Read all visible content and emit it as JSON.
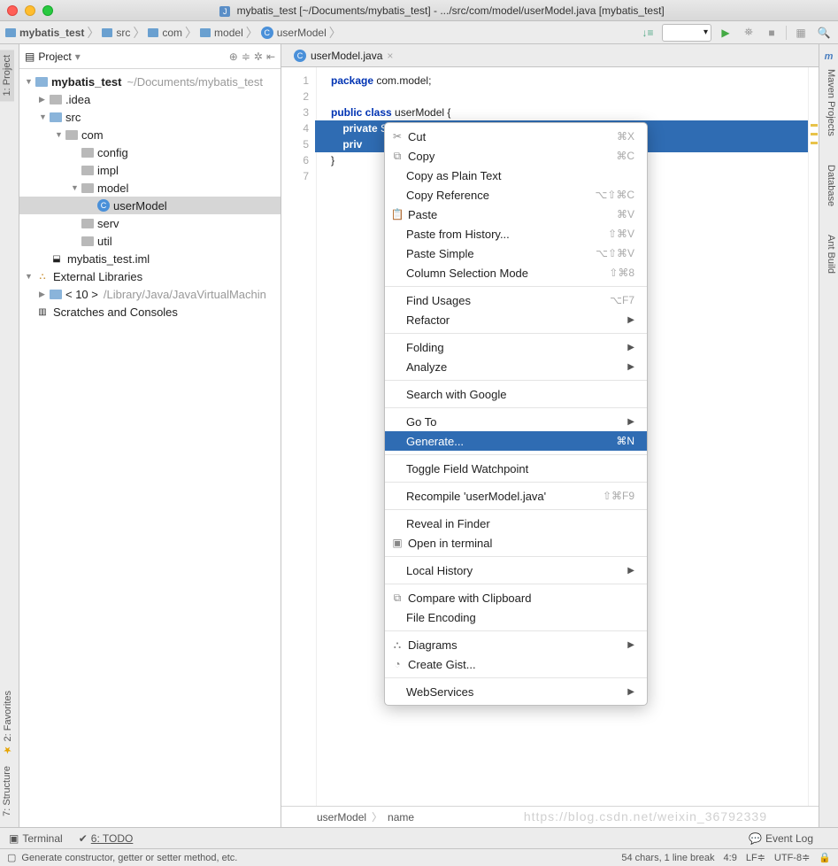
{
  "title": "mybatis_test [~/Documents/mybatis_test] - .../src/com/model/userModel.java [mybatis_test]",
  "breadcrumbs": [
    "mybatis_test",
    "src",
    "com",
    "model",
    "userModel"
  ],
  "project_panel": {
    "title": "Project",
    "tree": {
      "root": "mybatis_test",
      "root_path": "~/Documents/mybatis_test",
      "idea": ".idea",
      "src": "src",
      "com": "com",
      "config": "config",
      "impl": "impl",
      "model": "model",
      "userModel": "userModel",
      "serv": "serv",
      "util": "util",
      "iml": "mybatis_test.iml",
      "ext": "External Libraries",
      "jdk": "< 10 >",
      "jdk_path": "/Library/Java/JavaVirtualMachin",
      "scratches": "Scratches and Consoles"
    }
  },
  "editor": {
    "tab_label": "userModel.java",
    "lines": [
      "1",
      "2",
      "3",
      "4",
      "5",
      "6",
      "7"
    ],
    "code": {
      "l1_pre": "package ",
      "l1_pkg": "com.model;",
      "l3_a": "public class ",
      "l3_b": "userModel {",
      "l4_a": "private ",
      "l4_b": "String name;",
      "l5_a": "priv",
      "l6": "}"
    },
    "bc1": "userModel",
    "bc2": "name"
  },
  "context_menu": [
    {
      "label": "Cut",
      "icon": "✂",
      "shortcut": "⌘X"
    },
    {
      "label": "Copy",
      "icon": "⧉",
      "shortcut": "⌘C"
    },
    {
      "label": "Copy as Plain Text"
    },
    {
      "label": "Copy Reference",
      "shortcut": "⌥⇧⌘C"
    },
    {
      "label": "Paste",
      "icon": "📋",
      "shortcut": "⌘V"
    },
    {
      "label": "Paste from History...",
      "shortcut": "⇧⌘V"
    },
    {
      "label": "Paste Simple",
      "shortcut": "⌥⇧⌘V"
    },
    {
      "label": "Column Selection Mode",
      "shortcut": "⇧⌘8"
    },
    {
      "sep": true
    },
    {
      "label": "Find Usages",
      "shortcut": "⌥F7"
    },
    {
      "label": "Refactor",
      "sub": true
    },
    {
      "sep": true
    },
    {
      "label": "Folding",
      "sub": true
    },
    {
      "label": "Analyze",
      "sub": true
    },
    {
      "sep": true
    },
    {
      "label": "Search with Google"
    },
    {
      "sep": true
    },
    {
      "label": "Go To",
      "sub": true
    },
    {
      "label": "Generate...",
      "shortcut": "⌘N",
      "hl": true
    },
    {
      "sep": true
    },
    {
      "label": "Toggle Field Watchpoint"
    },
    {
      "sep": true
    },
    {
      "label": "Recompile 'userModel.java'",
      "shortcut": "⇧⌘F9"
    },
    {
      "sep": true
    },
    {
      "label": "Reveal in Finder"
    },
    {
      "label": "Open in terminal",
      "icon": "▣"
    },
    {
      "sep": true
    },
    {
      "label": "Local History",
      "sub": true
    },
    {
      "sep": true
    },
    {
      "label": "Compare with Clipboard",
      "icon": "⧉"
    },
    {
      "label": "File Encoding"
    },
    {
      "sep": true
    },
    {
      "label": "Diagrams",
      "icon": "⛬",
      "sub": true
    },
    {
      "label": "Create Gist...",
      "icon": "◔"
    },
    {
      "sep": true
    },
    {
      "label": "WebServices",
      "sub": true
    }
  ],
  "left_rail": {
    "project": "1: Project",
    "favorites": "2: Favorites",
    "structure": "7: Structure"
  },
  "right_rail": {
    "maven": "Maven Projects",
    "database": "Database",
    "ant": "Ant Build"
  },
  "bottom_tools": {
    "terminal": "Terminal",
    "todo": "6: TODO",
    "eventlog": "Event Log"
  },
  "status": {
    "msg": "Generate constructor, getter or setter method, etc.",
    "chars": "54 chars, 1 line break",
    "pos": "4:9",
    "lf": "LF≑",
    "enc": "UTF-8≑"
  },
  "watermark": "https://blog.csdn.net/weixin_36792339"
}
